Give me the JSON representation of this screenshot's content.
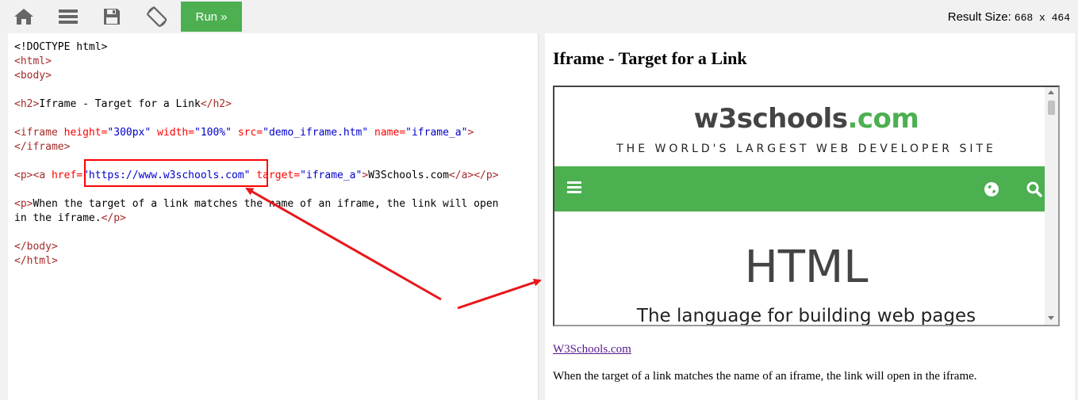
{
  "toolbar": {
    "run_label": "Run »",
    "result_size_label": "Result Size:",
    "result_size_value": "668 x 464",
    "icons": [
      "home-icon",
      "menu-icon",
      "save-icon",
      "rotate-icon"
    ]
  },
  "editor": {
    "code": {
      "doctype": "<!DOCTYPE html>",
      "html_open": "<html>",
      "body_open": "<body>",
      "h2_open": "<h2>",
      "h2_text": "Iframe - Target for a Link",
      "h2_close": "</h2>",
      "iframe_tag": "iframe",
      "iframe_attr_height": "height=",
      "iframe_val_height": "\"300px\"",
      "iframe_attr_width": "width=",
      "iframe_val_width": "\"100%\"",
      "iframe_attr_src": "src=",
      "iframe_val_src": "\"demo_iframe.htm\"",
      "iframe_attr_name": "name=",
      "iframe_val_name": "\"iframe_a\"",
      "iframe_close": "</iframe>",
      "p_open": "<p>",
      "a_tag": "a",
      "a_attr_href": "href=",
      "a_val_href": "\"https://www.w3schools.com\"",
      "a_attr_target": "target=",
      "a_val_target": "\"iframe_a\"",
      "a_text": "W3Schools.com",
      "a_close": "</a>",
      "p_close": "</p>",
      "p2_text_line1": "When the target of a link matches the name of an iframe, the link will open",
      "p2_text_line2": "in the iframe.",
      "body_close": "</body>",
      "html_close": "</html>"
    }
  },
  "result": {
    "heading": "Iframe - Target for a Link",
    "iframe": {
      "logo_main": "w3schools",
      "logo_suffix": ".com",
      "tagline": "THE WORLD'S LARGEST WEB DEVELOPER SITE",
      "big_title": "HTML",
      "subtitle": "The language for building web pages",
      "nav_color": "#4CAF50"
    },
    "link_text": "W3Schools.com",
    "paragraph": "When the target of a link matches the name of an iframe, the link will open in the iframe."
  },
  "annotations": {
    "highlight_color": "#ff0000",
    "arrow_color": "#e8161b"
  }
}
